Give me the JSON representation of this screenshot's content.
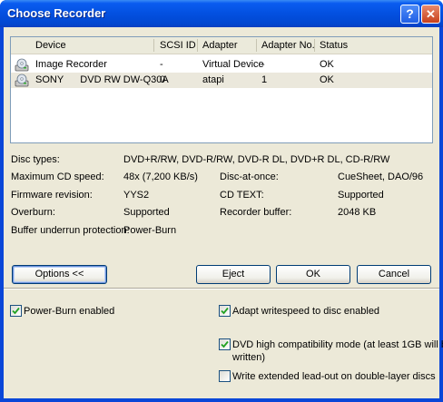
{
  "window": {
    "title": "Choose Recorder",
    "help_label": "?",
    "close_label": "✕"
  },
  "list": {
    "columns": [
      "Device",
      "SCSI ID",
      "Adapter",
      "Adapter No.",
      "Status"
    ],
    "rows": [
      {
        "device": "Image Recorder",
        "scsi_id": "-",
        "adapter": "Virtual Device",
        "adapter_no": "-",
        "status": "OK"
      },
      {
        "device": "SONY      DVD RW DW-Q30A",
        "scsi_id": "0",
        "adapter": "atapi",
        "adapter_no": "1",
        "status": "OK"
      }
    ]
  },
  "info": {
    "disc_types_label": "Disc types:",
    "disc_types_value": "DVD+R/RW, DVD-R/RW, DVD-R DL, DVD+R DL, CD-R/RW",
    "max_speed_label": "Maximum CD speed:",
    "max_speed_value": "48x (7,200 KB/s)",
    "dao_label": "Disc-at-once:",
    "dao_value": "CueSheet, DAO/96",
    "firmware_label": "Firmware revision:",
    "firmware_value": "YYS2",
    "cdtext_label": "CD TEXT:",
    "cdtext_value": "Supported",
    "overburn_label": "Overburn:",
    "overburn_value": "Supported",
    "buffer_label": "Recorder buffer:",
    "buffer_value": "2048 KB",
    "underrun_label": "Buffer underrun protection:",
    "underrun_value": "Power-Burn"
  },
  "buttons": {
    "options": "Options <<",
    "eject": "Eject",
    "ok": "OK",
    "cancel": "Cancel"
  },
  "options": {
    "power_burn": {
      "label": "Power-Burn enabled",
      "checked": true
    },
    "adapt_speed": {
      "label": "Adapt writespeed to disc enabled",
      "checked": true
    },
    "dvd_compat_line1": "DVD high compatibility mode (at least 1GB will be",
    "dvd_compat_line2": "written)",
    "dvd_compat_checked": true,
    "ext_leadout": {
      "label": "Write extended lead-out on double-layer discs",
      "checked": false
    }
  }
}
